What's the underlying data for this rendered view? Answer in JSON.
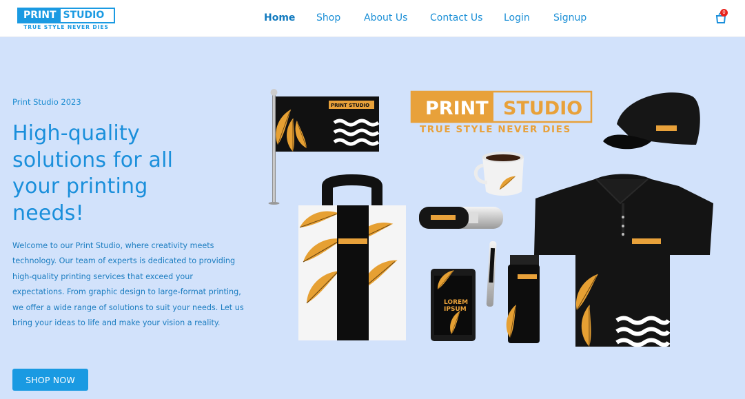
{
  "brand": {
    "name_part1": "PRINT",
    "name_part2": "STUDIO",
    "tagline": "TRUE STYLE NEVER DIES"
  },
  "nav": {
    "items": [
      {
        "label": "Home",
        "active": true
      },
      {
        "label": "Shop"
      },
      {
        "label": "About Us"
      },
      {
        "label": "Contact Us"
      },
      {
        "label": "Login"
      },
      {
        "label": "Signup"
      }
    ]
  },
  "cart": {
    "icon": "shopping-bag-icon",
    "count": "0"
  },
  "hero": {
    "eyebrow": "Print Studio 2023",
    "headline": "High-quality solutions for all your printing needs!",
    "description": "Welcome to our Print Studio, where creativity meets technology. Our team of experts is dedicated to providing high-quality printing services that exceed your expectations. From graphic design to large-format printing, we offer a wide range of solutions to suit your needs. Let us bring your ideas to life and make your vision a reality.",
    "cta_label": "SHOP NOW"
  },
  "illustration": {
    "logo_part1": "PRINT",
    "logo_part2": "STUDIO",
    "logo_tagline": "TRUE STYLE NEVER DIES",
    "phone_text_line1": "LOREM",
    "phone_text_line2": "IPSUM"
  },
  "colors": {
    "accent": "#1a9ae2",
    "background": "#d2e2fb",
    "merch_gold": "#e8a13a",
    "merch_black": "#111111",
    "badge": "#e8231d"
  }
}
